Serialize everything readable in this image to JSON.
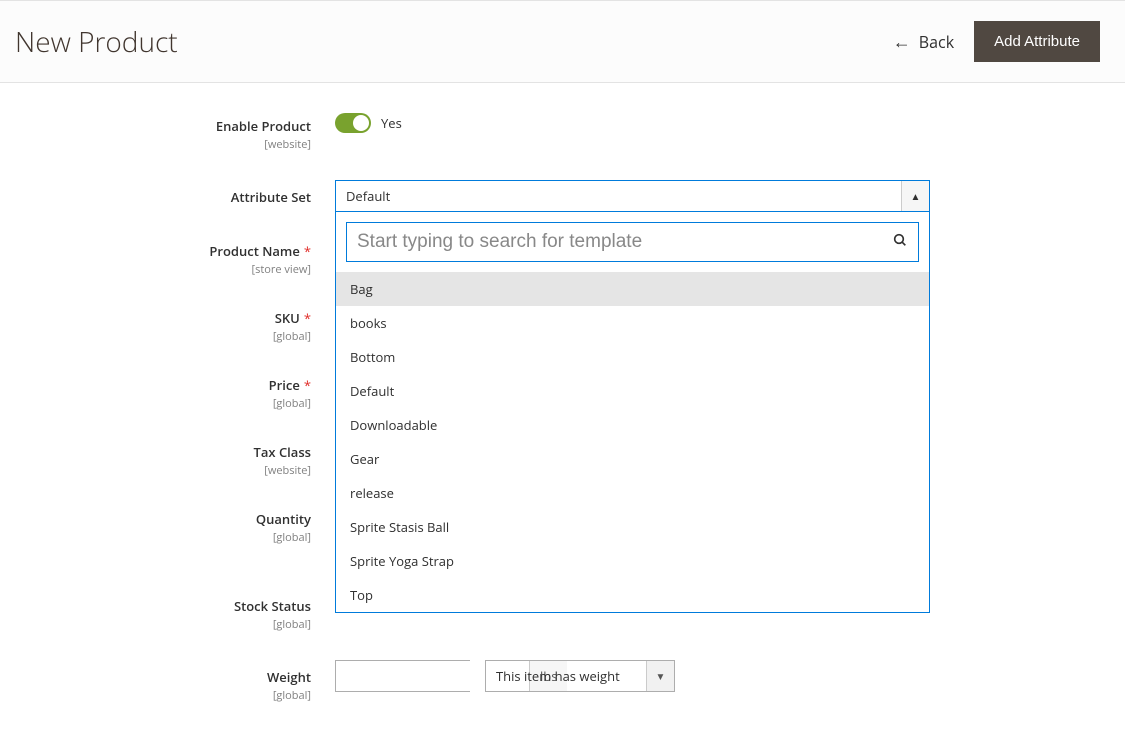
{
  "header": {
    "title": "New Product",
    "back_label": "Back",
    "add_attribute_label": "Add Attribute"
  },
  "form": {
    "enable_product": {
      "label": "Enable Product",
      "scope": "[website]",
      "value_text": "Yes",
      "value": true
    },
    "attribute_set": {
      "label": "Attribute Set",
      "selected": "Default",
      "search_placeholder": "Start typing to search for template",
      "options": [
        "Bag",
        "books",
        "Bottom",
        "Default",
        "Downloadable",
        "Gear",
        "release",
        "Sprite Stasis Ball",
        "Sprite Yoga Strap",
        "Top"
      ],
      "highlighted_index": 0
    },
    "product_name": {
      "label": "Product Name",
      "scope": "[store view]",
      "required": true
    },
    "sku": {
      "label": "SKU",
      "scope": "[global]",
      "required": true
    },
    "price": {
      "label": "Price",
      "scope": "[global]",
      "required": true
    },
    "tax_class": {
      "label": "Tax Class",
      "scope": "[website]"
    },
    "quantity": {
      "label": "Quantity",
      "scope": "[global]"
    },
    "stock_status": {
      "label": "Stock Status",
      "scope": "[global]"
    },
    "weight": {
      "label": "Weight",
      "scope": "[global]",
      "unit": "lbs",
      "has_weight_text": "This item has weight"
    }
  }
}
